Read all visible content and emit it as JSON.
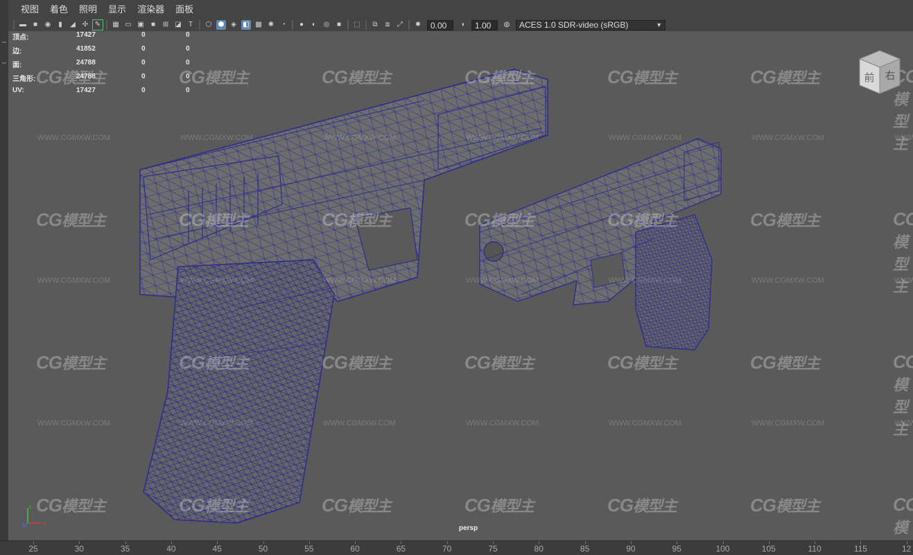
{
  "menu": [
    "视图",
    "着色",
    "照明",
    "显示",
    "渲染器",
    "面板"
  ],
  "toolbar": {
    "exposure": "0.00",
    "gamma": "1.00",
    "color_space": "ACES 1.0 SDR-video (sRGB)",
    "icons": [
      "camera-icon",
      "camera-lock-icon",
      "camera-attr-icon",
      "bookmark-icon",
      "image-plane-icon",
      "2d-pan-icon",
      "grease-pencil-icon",
      "grid-icon",
      "film-gate-icon",
      "resolution-gate-icon",
      "gate-mask-icon",
      "field-chart-icon",
      "safe-action-icon",
      "safe-title-icon",
      "wireframe-icon",
      "smooth-shade-icon",
      "shade-wireframe-icon",
      "xray-icon",
      "use-lights-icon",
      "shadows-icon",
      "ambient-occlusion-icon",
      "motion-blur-icon",
      "anti-alias-icon",
      "depth-of-field-icon",
      "isolate-select-icon",
      "xray-joints-icon",
      "xray-active-icon",
      "backface-icon",
      "exposure-icon",
      "gamma-icon",
      "color-management-icon"
    ]
  },
  "hud": {
    "rows": [
      {
        "label": "顶点:",
        "v1": "17427",
        "v2": "0",
        "v3": "0"
      },
      {
        "label": "边:",
        "v1": "41852",
        "v2": "0",
        "v3": "0"
      },
      {
        "label": "面:",
        "v1": "24788",
        "v2": "0",
        "v3": "0"
      },
      {
        "label": "三角形:",
        "v1": "24788",
        "v2": "0",
        "v3": "0"
      },
      {
        "label": "UV:",
        "v1": "17427",
        "v2": "0",
        "v3": "0"
      }
    ]
  },
  "viewport": {
    "camera": "persp",
    "viewcube_front": "前",
    "viewcube_right": "右",
    "axis_labels": [
      "x",
      "y",
      "z"
    ]
  },
  "watermark": {
    "logo": "CG",
    "logo_cn": "模型主",
    "url": "WWW.CGMXW.COM"
  },
  "ruler": {
    "labels": [
      "25",
      "30",
      "35",
      "40",
      "45",
      "50",
      "55",
      "60",
      "65",
      "70",
      "75",
      "80",
      "85",
      "90",
      "95",
      "100",
      "105",
      "110",
      "115",
      "12"
    ]
  },
  "colors": {
    "wire": "#2d2d8c",
    "viewport_bg": "#5a5a5a",
    "ui_bg": "#444444",
    "active_blue": "#5d8ab3"
  }
}
